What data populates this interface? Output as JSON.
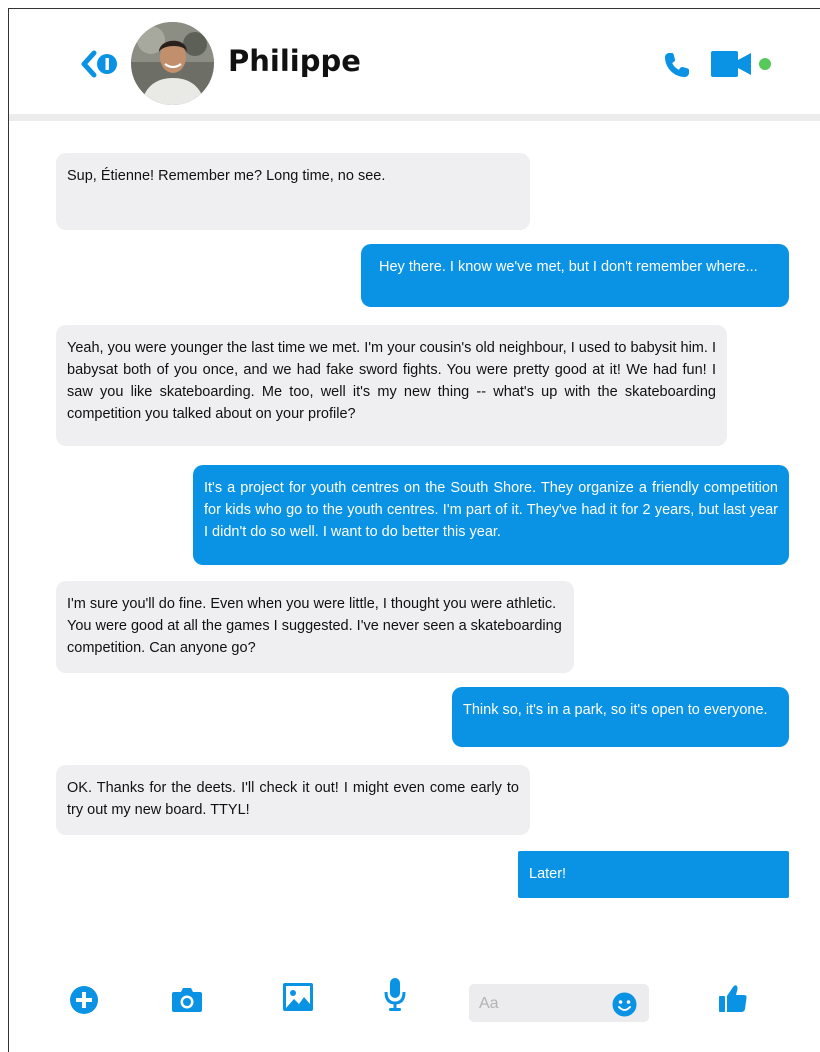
{
  "header": {
    "contact_name": "Philippe",
    "back_icon": "back-chevron-icon",
    "call_icon": "phone-icon",
    "video_icon": "video-camera-icon",
    "online_status": "online",
    "accent_color": "#0a92e4",
    "online_color": "#57c95c"
  },
  "messages": [
    {
      "direction": "incoming",
      "text": "Sup, Étienne! Remember me? Long time, no see."
    },
    {
      "direction": "outgoing",
      "text": "Hey there. I know we've met, but I don't remember where..."
    },
    {
      "direction": "incoming",
      "text": "Yeah,  you were younger the last time we met.  I'm your cousin's old neighbour, I used to babysit him. I babysat both of you once, and we had fake sword fights. You were pretty good at it! We had fun!  I saw you like skateboarding.  Me too, well it's my new thing -- what's up with the skateboarding competition you talked about on your profile?"
    },
    {
      "direction": "outgoing",
      "text": "It's a project for youth centres on the South Shore. They organize a friendly competition for kids who go to the youth centres.  I'm part of it. They've had it for 2 years, but last year I didn't do so well. I want to do better this year."
    },
    {
      "direction": "incoming",
      "text": "I'm sure you'll do fine. Even when you were little, I thought you were athletic.  You were good at all the games I suggested. I've never seen a skateboarding competition. Can anyone go?"
    },
    {
      "direction": "outgoing",
      "text": "Think so, it's in a park, so it's open to everyone."
    },
    {
      "direction": "incoming",
      "text": "OK. Thanks for the deets. I'll check it out! I might even come early to try out my new board. TTYL!"
    },
    {
      "direction": "outgoing",
      "text": "Later!"
    }
  ],
  "toolbar": {
    "icons": [
      "plus-icon",
      "camera-icon",
      "image-icon",
      "microphone-icon",
      "emoji-icon",
      "thumbs-up-icon"
    ],
    "compose_placeholder": "Aa"
  }
}
